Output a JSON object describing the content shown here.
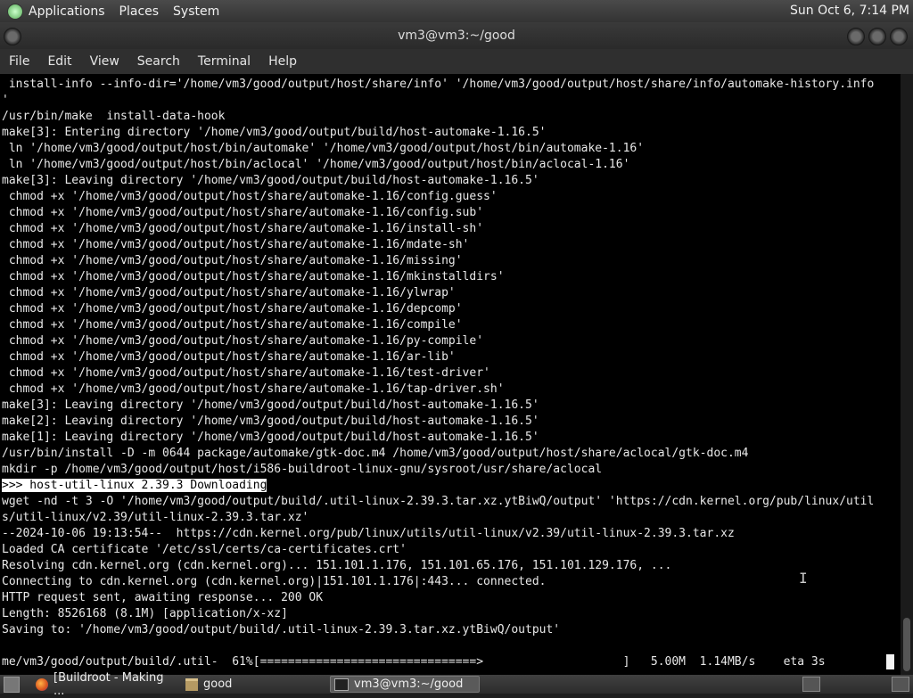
{
  "top_panel": {
    "menus": [
      "Applications",
      "Places",
      "System"
    ],
    "clock": "Sun Oct  6,  7:14 PM"
  },
  "window": {
    "title": "vm3@vm3:~/good"
  },
  "menubar": [
    "File",
    "Edit",
    "View",
    "Search",
    "Terminal",
    "Help"
  ],
  "terminal": {
    "lines": [
      " install-info --info-dir='/home/vm3/good/output/host/share/info' '/home/vm3/good/output/host/share/info/automake-history.info",
      "'",
      "/usr/bin/make  install-data-hook",
      "make[3]: Entering directory '/home/vm3/good/output/build/host-automake-1.16.5'",
      " ln '/home/vm3/good/output/host/bin/automake' '/home/vm3/good/output/host/bin/automake-1.16'",
      " ln '/home/vm3/good/output/host/bin/aclocal' '/home/vm3/good/output/host/bin/aclocal-1.16'",
      "make[3]: Leaving directory '/home/vm3/good/output/build/host-automake-1.16.5'",
      " chmod +x '/home/vm3/good/output/host/share/automake-1.16/config.guess'",
      " chmod +x '/home/vm3/good/output/host/share/automake-1.16/config.sub'",
      " chmod +x '/home/vm3/good/output/host/share/automake-1.16/install-sh'",
      " chmod +x '/home/vm3/good/output/host/share/automake-1.16/mdate-sh'",
      " chmod +x '/home/vm3/good/output/host/share/automake-1.16/missing'",
      " chmod +x '/home/vm3/good/output/host/share/automake-1.16/mkinstalldirs'",
      " chmod +x '/home/vm3/good/output/host/share/automake-1.16/ylwrap'",
      " chmod +x '/home/vm3/good/output/host/share/automake-1.16/depcomp'",
      " chmod +x '/home/vm3/good/output/host/share/automake-1.16/compile'",
      " chmod +x '/home/vm3/good/output/host/share/automake-1.16/py-compile'",
      " chmod +x '/home/vm3/good/output/host/share/automake-1.16/ar-lib'",
      " chmod +x '/home/vm3/good/output/host/share/automake-1.16/test-driver'",
      " chmod +x '/home/vm3/good/output/host/share/automake-1.16/tap-driver.sh'",
      "make[3]: Leaving directory '/home/vm3/good/output/build/host-automake-1.16.5'",
      "make[2]: Leaving directory '/home/vm3/good/output/build/host-automake-1.16.5'",
      "make[1]: Leaving directory '/home/vm3/good/output/build/host-automake-1.16.5'",
      "/usr/bin/install -D -m 0644 package/automake/gtk-doc.m4 /home/vm3/good/output/host/share/aclocal/gtk-doc.m4",
      "mkdir -p /home/vm3/good/output/host/i586-buildroot-linux-gnu/sysroot/usr/share/aclocal",
      ">>> host-util-linux 2.39.3 Downloading",
      "wget -nd -t 3 -O '/home/vm3/good/output/build/.util-linux-2.39.3.tar.xz.ytBiwQ/output' 'https://cdn.kernel.org/pub/linux/util",
      "s/util-linux/v2.39/util-linux-2.39.3.tar.xz'",
      "--2024-10-06 19:13:54--  https://cdn.kernel.org/pub/linux/utils/util-linux/v2.39/util-linux-2.39.3.tar.xz",
      "Loaded CA certificate '/etc/ssl/certs/ca-certificates.crt'",
      "Resolving cdn.kernel.org (cdn.kernel.org)... 151.101.1.176, 151.101.65.176, 151.101.129.176, ...",
      "Connecting to cdn.kernel.org (cdn.kernel.org)|151.101.1.176|:443... connected.",
      "HTTP request sent, awaiting response... 200 OK",
      "Length: 8526168 (8.1M) [application/x-xz]",
      "Saving to: '/home/vm3/good/output/build/.util-linux-2.39.3.tar.xz.ytBiwQ/output'",
      "",
      "me/vm3/good/output/build/.util-  61%[===============================>                    ]   5.00M  1.14MB/s    eta 3s"
    ],
    "highlight_line": ">>> host-util-linux 2.39.3 Downloading"
  },
  "taskbar": {
    "tasks": [
      {
        "label": "[Buildroot - Making ...",
        "icon": "firefox-icon"
      },
      {
        "label": "good",
        "icon": "folder-icon"
      },
      {
        "label": "vm3@vm3:~/good",
        "icon": "terminal-icon"
      }
    ]
  }
}
